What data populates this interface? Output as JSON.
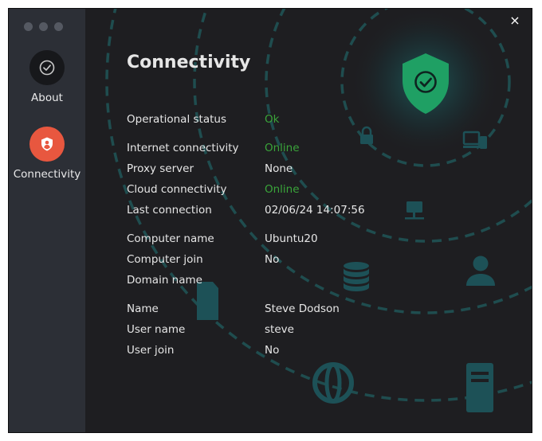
{
  "sidebar": {
    "items": [
      {
        "label": "About",
        "icon": "check-circle-icon"
      },
      {
        "label": "Connectivity",
        "icon": "shield-user-icon"
      }
    ]
  },
  "window": {
    "close_label": "×"
  },
  "main": {
    "title": "Connectivity",
    "rows": [
      {
        "label": "Operational status",
        "value": "Ok",
        "status": "ok"
      },
      {
        "label": "Internet connectivity",
        "value": "Online",
        "status": "ok"
      },
      {
        "label": "Proxy server",
        "value": "None"
      },
      {
        "label": "Cloud connectivity",
        "value": "Online",
        "status": "ok"
      },
      {
        "label": "Last connection",
        "value": "02/06/24 14:07:56"
      },
      {
        "label": "Computer name",
        "value": "Ubuntu20"
      },
      {
        "label": "Computer join",
        "value": "No"
      },
      {
        "label": "Domain name",
        "value": ""
      },
      {
        "label": "Name",
        "value": "Steve Dodson"
      },
      {
        "label": "User name",
        "value": "steve"
      },
      {
        "label": "User join",
        "value": "No"
      }
    ]
  },
  "colors": {
    "window_bg": "#1e1e21",
    "sidebar_bg": "#2c2f36",
    "status_ok": "#3aa53a",
    "accent_orange": "#e8573f",
    "shield_green": "#1fa064",
    "decor_teal": "#1d5157"
  }
}
